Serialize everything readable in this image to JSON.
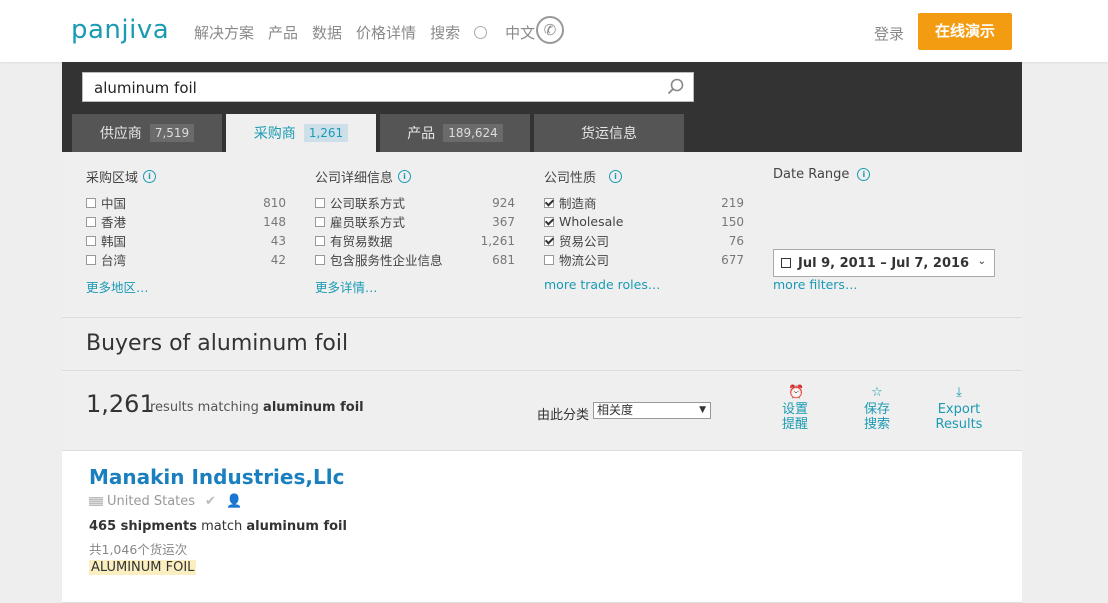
{
  "header": {
    "logo": "panjiva",
    "nav": [
      "解决方案",
      "产品",
      "数据",
      "价格详情",
      "搜索"
    ],
    "language": "中文",
    "login": "登录",
    "demo_button": "在线演示"
  },
  "search": {
    "value": "aluminum foil"
  },
  "tabs": [
    {
      "label": "供应商",
      "count": "7,519",
      "active": false
    },
    {
      "label": "采购商",
      "count": "1,261",
      "active": true
    },
    {
      "label": "产品",
      "count": "189,624",
      "active": false
    },
    {
      "label": "货运信息",
      "count": "",
      "active": false
    }
  ],
  "filters": {
    "region": {
      "title": "采购区域",
      "items": [
        {
          "label": "中国",
          "count": "810",
          "checked": false
        },
        {
          "label": "香港",
          "count": "148",
          "checked": false
        },
        {
          "label": "韩国",
          "count": "43",
          "checked": false
        },
        {
          "label": "台湾",
          "count": "42",
          "checked": false
        }
      ],
      "more": "更多地区…"
    },
    "company": {
      "title": "公司详细信息",
      "items": [
        {
          "label": "公司联系方式",
          "count": "924",
          "checked": false
        },
        {
          "label": "雇员联系方式",
          "count": "367",
          "checked": false
        },
        {
          "label": "有贸易数据",
          "count": "1,261",
          "checked": false
        },
        {
          "label": "包含服务性企业信息",
          "count": "681",
          "checked": false
        }
      ],
      "more": "更多详情…"
    },
    "nature": {
      "title": "公司性质",
      "items": [
        {
          "label": "制造商",
          "count": "219",
          "checked": true
        },
        {
          "label": "Wholesale",
          "count": "150",
          "checked": true
        },
        {
          "label": "贸易公司",
          "count": "76",
          "checked": true
        },
        {
          "label": "物流公司",
          "count": "677",
          "checked": false
        }
      ],
      "more": "more trade roles…"
    },
    "date": {
      "title": "Date Range",
      "value": "Jul 9, 2011 – Jul 7, 2016",
      "more": "more filters…"
    }
  },
  "page_title": "Buyers of aluminum foil",
  "results": {
    "count": "1,261",
    "text_prefix": "results matching",
    "query": "aluminum foil",
    "sort_label": "由此分类",
    "sort_value": "相关度",
    "actions": [
      {
        "icon": "alarm-clock-icon",
        "line1": "设置",
        "line2": "提醒"
      },
      {
        "icon": "star-icon",
        "line1": "保存",
        "line2": "搜索"
      },
      {
        "icon": "download-icon",
        "line1": "Export",
        "line2": "Results"
      }
    ]
  },
  "result_item": {
    "company": "Manakin Industries,Llc",
    "country": "United States",
    "shipments": "465 shipments",
    "match_text": "match",
    "query": "aluminum foil",
    "total": "共1,046个货运次",
    "tag": "ALUMINUM FOIL"
  },
  "colors": {
    "brand": "#1a9bb3",
    "accent": "#f39c12",
    "link": "#1a7fbf"
  }
}
